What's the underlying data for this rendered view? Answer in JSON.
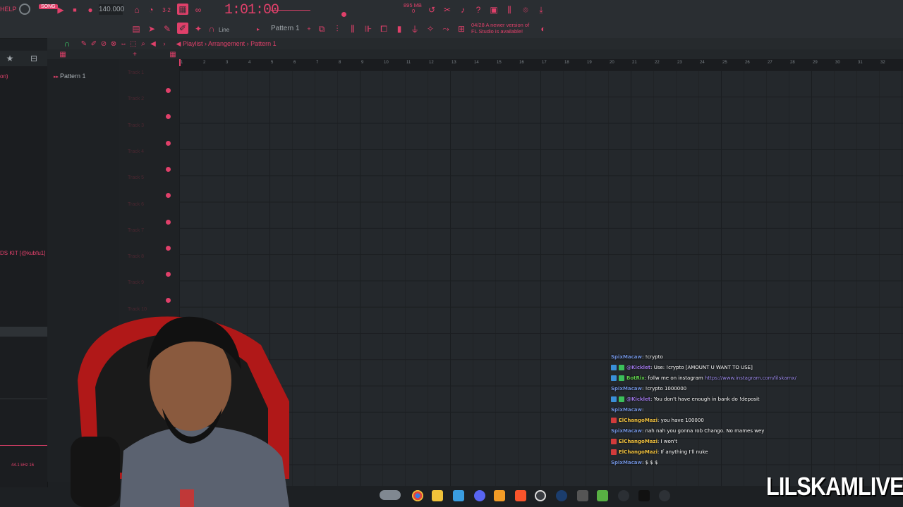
{
  "toolbar": {
    "help_label": "HELP",
    "song_badge": "SONG",
    "bpm": "140.000",
    "time": "1:01:00",
    "time_sub": "M:S:CS",
    "memory": "895 MB",
    "cpu": "0",
    "mode_label": "Line",
    "pattern": "Pattern 1",
    "news_date": "04/28",
    "news_text": "A newer version of FL Studio is available!"
  },
  "browser": {
    "entry_top": "on)",
    "entry_mid": "DS KIT [@kubfu1]",
    "sample_rate": "44.1 kHz 16"
  },
  "playlist": {
    "breadcrumb": [
      "Playlist",
      "Arrangement",
      "Pattern 1"
    ],
    "picker_item": "Pattern 1",
    "ruler": [
      "1",
      "2",
      "3",
      "4",
      "5",
      "6",
      "7",
      "8",
      "9",
      "10",
      "11",
      "12",
      "13",
      "14",
      "15",
      "16",
      "17",
      "18",
      "19",
      "20",
      "21",
      "22",
      "23",
      "24",
      "25",
      "26",
      "27",
      "28",
      "29",
      "30",
      "31",
      "32"
    ],
    "tracks": [
      "Track 1",
      "Track 2",
      "Track 3",
      "Track 4",
      "Track 5",
      "Track 6",
      "Track 7",
      "Track 8",
      "Track 9",
      "Track 10"
    ]
  },
  "chat": [
    {
      "user": "SpixMacaw",
      "color": "blue",
      "text": ": !crypto",
      "badges": 0
    },
    {
      "user": "@Kicklet",
      "color": "purple",
      "text": ": Use: !crypto [AMOUNT U WANT TO USE]",
      "badges": 2
    },
    {
      "user": "BotRix",
      "color": "green",
      "text": ": follw me on instagram ",
      "link": "https://www.instagram.com/lilskamx/",
      "badges": 2
    },
    {
      "user": "SpixMacaw",
      "color": "blue",
      "text": ": !crypto 1000000",
      "badges": 0
    },
    {
      "user": "@Kicklet",
      "color": "purple",
      "text": ": You don't have enough in bank do !deposit",
      "badges": 2
    },
    {
      "user": "SpixMacaw",
      "color": "blue",
      "text": ": ",
      "badges": 0
    },
    {
      "user": "ElChangoMazi",
      "color": "orange",
      "text": ": you have 100000",
      "badges": 1
    },
    {
      "user": "SpixMacaw",
      "color": "blue",
      "text": ": nah nah you gonna rob Chango. No mames wey",
      "badges": 0
    },
    {
      "user": "ElChangoMazi",
      "color": "orange",
      "text": ": I won't",
      "badges": 1
    },
    {
      "user": "ElChangoMazi",
      "color": "orange",
      "text": ": If anything I'll nuke",
      "badges": 1
    },
    {
      "user": "SpixMacaw",
      "color": "blue",
      "text": ": $ $ $",
      "badges": 0
    }
  ],
  "watermark": "LILSKAMLIVE",
  "colors": {
    "accent": "#e0406a",
    "bg": "#1d2023",
    "grid": "#24282c"
  }
}
